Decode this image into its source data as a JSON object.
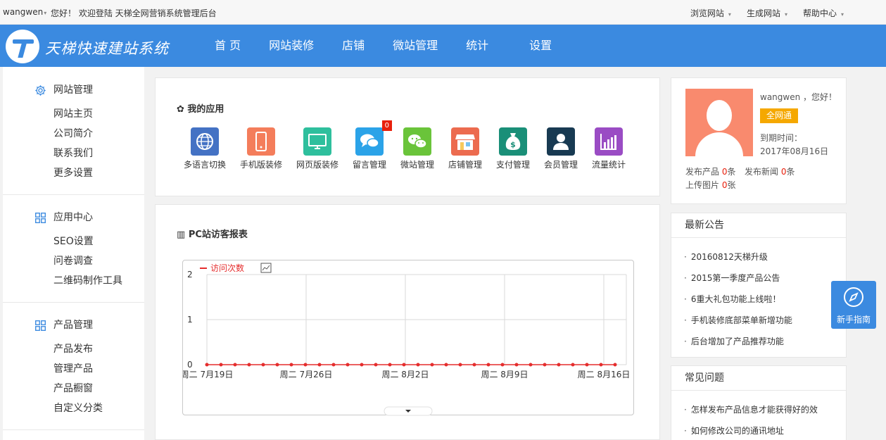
{
  "topbar": {
    "username": "wangwen",
    "welcome": "您好！ 欢迎登陆 天梯全网营销系统管理后台",
    "links": [
      "浏览网站",
      "生成网站",
      "帮助中心"
    ]
  },
  "header": {
    "brand": "天梯快速建站系统",
    "nav": [
      "首 页",
      "网站装修",
      "店铺",
      "微站管理",
      "统计",
      "设置"
    ]
  },
  "sidebar": {
    "groups": [
      {
        "title": "网站管理",
        "icon": "gear-icon",
        "items": [
          "网站主页",
          "公司简介",
          "联系我们",
          "更多设置"
        ]
      },
      {
        "title": "应用中心",
        "icon": "grid-icon",
        "items": [
          "SEO设置",
          "问卷调查",
          "二维码制作工具"
        ]
      },
      {
        "title": "产品管理",
        "icon": "grid-icon",
        "items": [
          "产品发布",
          "管理产品",
          "产品橱窗",
          "自定义分类"
        ]
      }
    ]
  },
  "apps": {
    "title": "我的应用",
    "items": [
      {
        "label": "多语言切换",
        "icon": "globe-icon",
        "color": "#4472c4"
      },
      {
        "label": "手机版装修",
        "icon": "mobile-icon",
        "color": "#f47d5b"
      },
      {
        "label": "网页版装修",
        "icon": "monitor-icon",
        "color": "#2ebf9d"
      },
      {
        "label": "留言管理",
        "icon": "chat-icon",
        "color": "#2ba3e8",
        "badge": "0"
      },
      {
        "label": "微站管理",
        "icon": "wechat-icon",
        "color": "#6ac43a"
      },
      {
        "label": "店铺管理",
        "icon": "store-icon",
        "color": "#ec6b4f"
      },
      {
        "label": "支付管理",
        "icon": "money-bag-icon",
        "color": "#1a8f78"
      },
      {
        "label": "会员管理",
        "icon": "member-icon",
        "color": "#183a52"
      },
      {
        "label": "流量统计",
        "icon": "bar-chart-icon",
        "color": "#9a4cc4"
      }
    ]
  },
  "chart_panel": {
    "title": "PC站访客报表"
  },
  "chart_data": {
    "type": "line",
    "title": "",
    "series": [
      {
        "name": "访问次数",
        "color": "#e52d2d",
        "values": [
          0,
          0,
          0,
          0,
          0,
          0,
          0,
          0,
          0,
          0,
          0,
          0,
          0,
          0,
          0,
          0,
          0,
          0,
          0,
          0,
          0,
          0,
          0,
          0,
          0,
          0,
          0,
          0,
          0,
          0
        ]
      }
    ],
    "x_tick_labels": [
      "周二 7月19日",
      "周二 7月26日",
      "周二 8月2日",
      "周二 8月9日",
      "周二 8月16日"
    ],
    "y_ticks": [
      "0",
      "1",
      "2"
    ],
    "ylim": [
      0,
      2
    ],
    "grid": true,
    "legend": "top-left"
  },
  "user": {
    "name": "wangwen ，您好！",
    "badge": "全网通",
    "expire_label": "到期时间：",
    "expire_date": "2017年08月16日",
    "stats": [
      {
        "label": "发布产品",
        "value": "0",
        "unit": "条"
      },
      {
        "label": "发布新闻",
        "value": "0",
        "unit": "条"
      },
      {
        "label": "上传图片",
        "value": "0",
        "unit": "张"
      }
    ]
  },
  "notices": {
    "title": "最新公告",
    "items": [
      "20160812天梯升级",
      "2015第一季度产品公告",
      "6重大礼包功能上线啦！",
      "手机装修底部菜单新增功能",
      "后台增加了产品推荐功能"
    ]
  },
  "faq": {
    "title": "常见问题",
    "items": [
      "怎样发布产品信息才能获得好的效",
      "如何修改公司的通讯地址"
    ]
  },
  "guide": {
    "label": "新手指南"
  }
}
